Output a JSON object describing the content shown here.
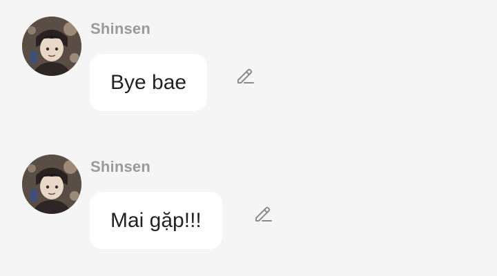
{
  "messages": [
    {
      "sender": "Shinsen",
      "text": "Bye bae",
      "avatar_icon": "user-avatar-photo",
      "action_icon": "pencil-edit-icon"
    },
    {
      "sender": "Shinsen",
      "text": "Mai gặp!!!",
      "avatar_icon": "user-avatar-photo",
      "action_icon": "pencil-edit-icon"
    }
  ],
  "colors": {
    "background": "#f5f5f5",
    "bubble": "#ffffff",
    "sender_name": "#9a9a9a",
    "message_text": "#222222",
    "icon": "#8a8a8a"
  }
}
